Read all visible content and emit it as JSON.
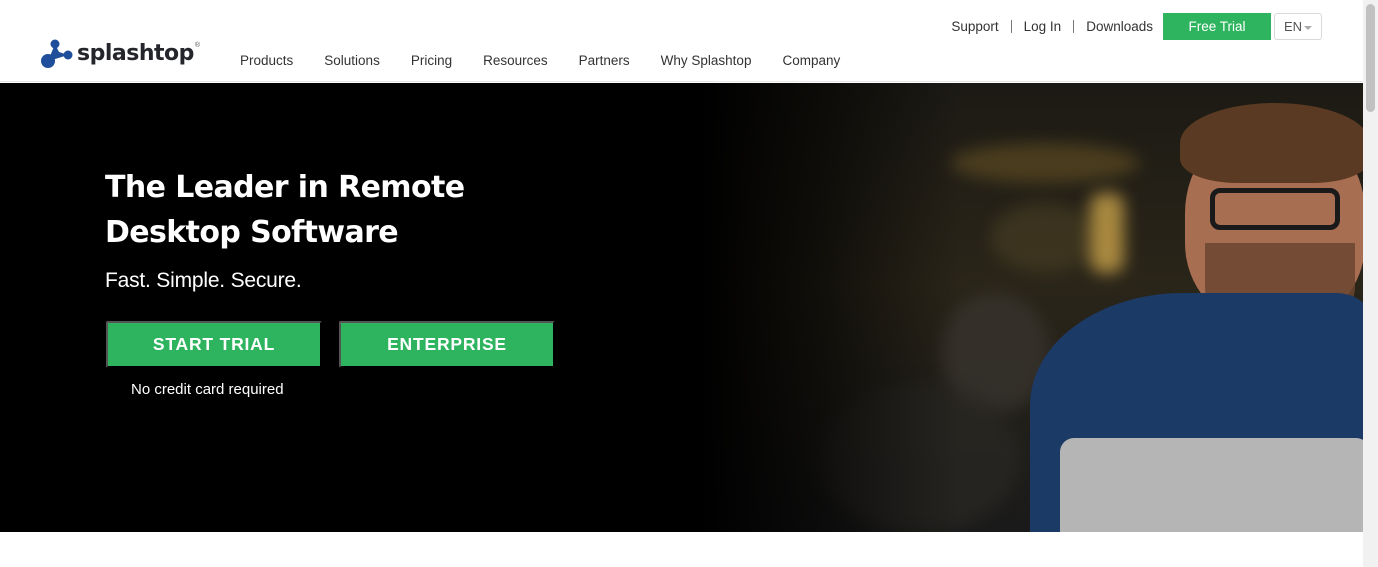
{
  "brand": {
    "name": "splashtop",
    "reg": "®",
    "accent": "#2eb45e"
  },
  "util_nav": {
    "support": "Support",
    "login": "Log In",
    "downloads": "Downloads",
    "free_trial": "Free Trial",
    "language": "EN"
  },
  "main_nav": {
    "items": [
      "Products",
      "Solutions",
      "Pricing",
      "Resources",
      "Partners",
      "Why Splashtop",
      "Company"
    ]
  },
  "hero": {
    "title_line1": "The Leader in Remote",
    "title_line2": "Desktop Software",
    "subtitle": "Fast. Simple. Secure.",
    "start_trial": "START TRIAL",
    "enterprise": "ENTERPRISE",
    "note": "No credit card required"
  },
  "icons": [
    "splashtop-logo-icon",
    "chevron-down-icon"
  ]
}
